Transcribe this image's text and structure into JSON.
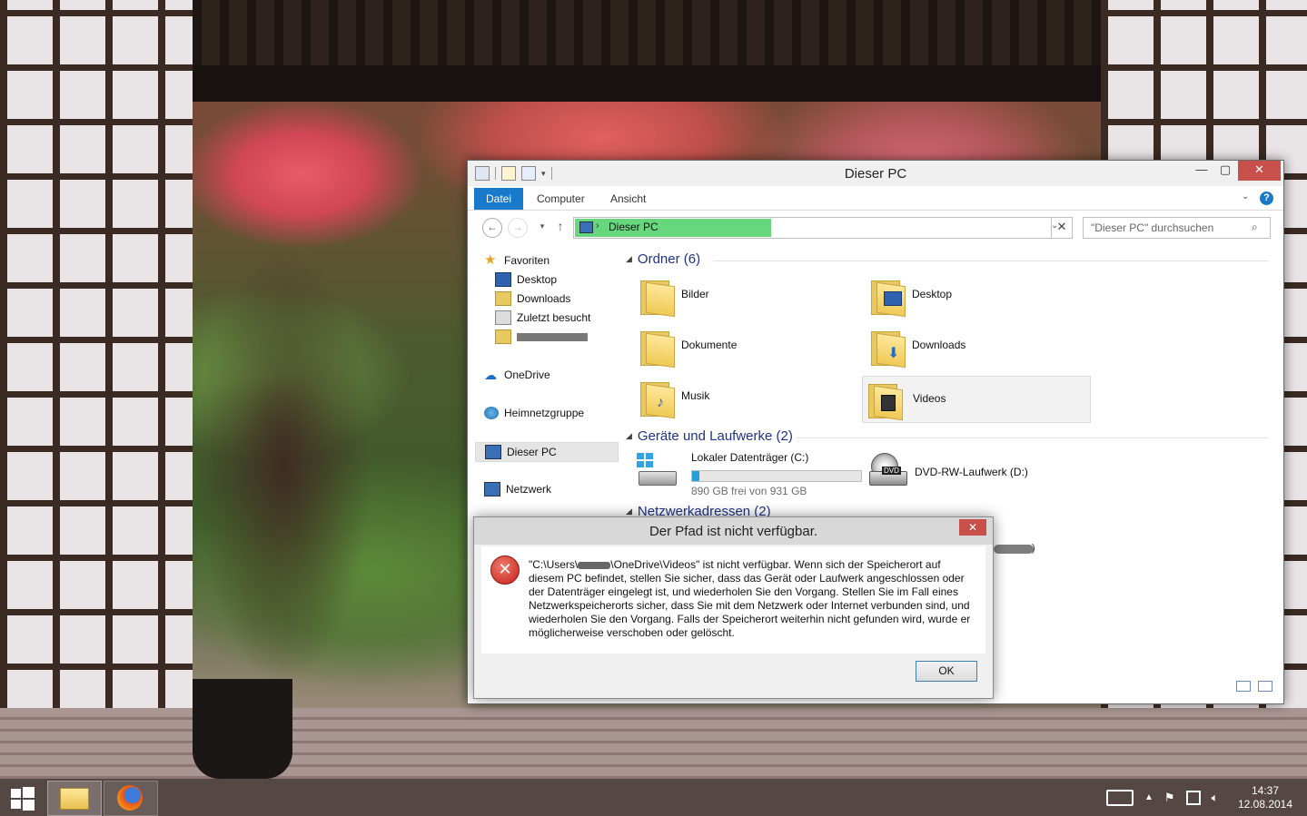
{
  "window": {
    "title": "Dieser PC",
    "min_label": "—",
    "max_label": "▢",
    "close_label": "✕",
    "ribbon_tabs": [
      "Datei",
      "Computer",
      "Ansicht"
    ],
    "help_label": "?"
  },
  "navigation": {
    "back_glyph": "←",
    "forward_glyph": "→",
    "recent_glyph": "▾",
    "up_glyph": "↑",
    "address_arrow": "›",
    "address": "Dieser PC",
    "address_dropdown": "⌄",
    "address_clear": "✕",
    "search_placeholder": "\"Dieser PC\" durchsuchen",
    "search_glyph": "⌕"
  },
  "nav_pane": {
    "items": [
      {
        "label": "Favoriten",
        "icon": "star-icon"
      },
      {
        "label": "Desktop",
        "icon": "desktop-icon"
      },
      {
        "label": "Downloads",
        "icon": "downloads-icon"
      },
      {
        "label": "Zuletzt besucht",
        "icon": "recent-places-icon"
      },
      {
        "label": "",
        "icon": "user-folder-icon",
        "redacted": true
      },
      {
        "label": "OneDrive",
        "icon": "onedrive-icon"
      },
      {
        "label": "Heimnetzgruppe",
        "icon": "homegroup-icon"
      },
      {
        "label": "Dieser PC",
        "icon": "computer-icon",
        "selected": true
      },
      {
        "label": "Netzwerk",
        "icon": "network-icon"
      }
    ]
  },
  "content": {
    "group_folders": "Ordner (6)",
    "group_drives": "Geräte und Laufwerke (2)",
    "group_network": "Netzwerkadressen (2)",
    "folders": [
      "Bilder",
      "Desktop",
      "Dokumente",
      "Downloads",
      "Musik",
      "Videos"
    ],
    "drive_c": {
      "label": "Lokaler Datenträger (C:)",
      "free_text": "890 GB frei von 931 GB",
      "used_fraction": 0.044
    },
    "drive_d": {
      "label": "DVD-RW-Laufwerk (D:)",
      "badge": "DVD"
    },
    "peek_paren": ")"
  },
  "dialog": {
    "title": "Der Pfad ist nicht verfügbar.",
    "close_label": "✕",
    "icon_glyph": "✕",
    "message_prefix": "\"C:\\Users\\",
    "message_rest": "\\OneDrive\\Videos\" ist nicht verfügbar. Wenn sich der Speicherort auf diesem PC befindet, stellen Sie sicher, dass das Gerät oder Laufwerk angeschlossen oder der Datenträger eingelegt ist, und wiederholen Sie den Vorgang. Stellen Sie im Fall eines Netzwerkspeicherorts sicher, dass Sie mit dem Netzwerk oder Internet verbunden sind, und wiederholen Sie den Vorgang. Falls der Speicherort weiterhin nicht gefunden wird, wurde er möglicherweise verschoben oder gelöscht.",
    "ok_label": "OK"
  },
  "taskbar": {
    "apps": [
      "file-explorer",
      "firefox"
    ],
    "time": "14:37",
    "date": "12.08.2014",
    "tray_icons": [
      "keyboard-icon",
      "show-hidden-icons-icon",
      "action-center-flag-icon",
      "network-icon",
      "volume-icon"
    ]
  },
  "colors": {
    "accent": "#1979ca",
    "address_highlight": "#67d77e",
    "close_red": "#c7504a",
    "group_header": "#1e3287"
  }
}
